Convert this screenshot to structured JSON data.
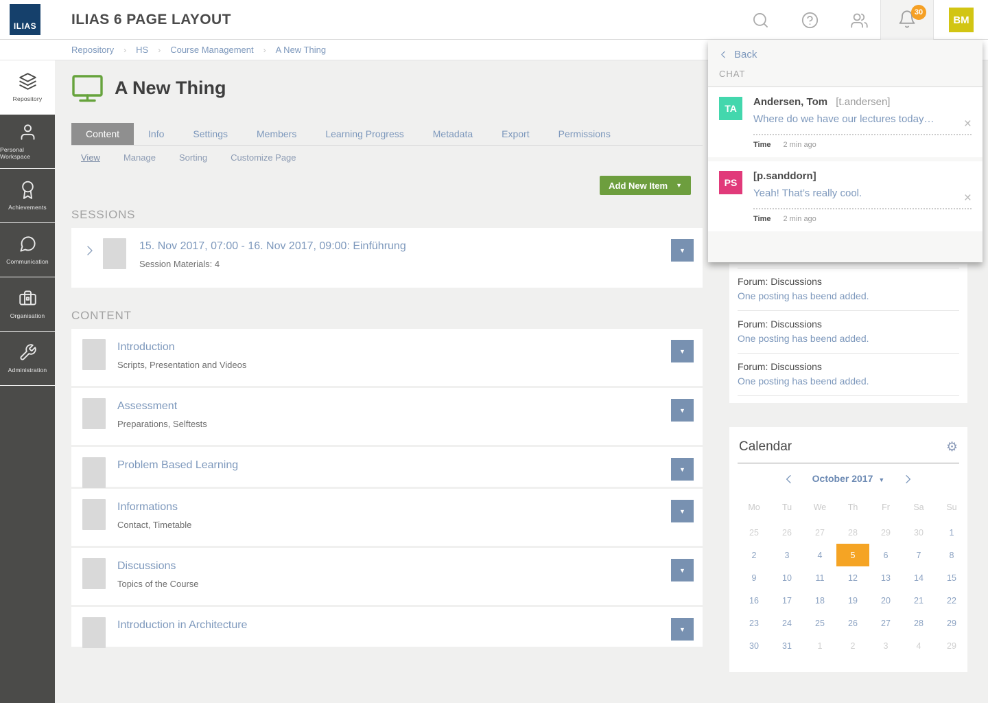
{
  "colors": {
    "accent_link": "#7d98bc",
    "green_button": "#6d9e3e",
    "orange_badge": "#f5a025",
    "orange_selected_day": "#f5a424",
    "navy_logo": "#15406b",
    "sidebar_dark": "#4b4b49",
    "avatar_bm": "#d2c513",
    "avatar_ta": "#43d7ad",
    "avatar_ps": "#e13a7a",
    "dropdown_blue": "#7891b1",
    "tab_active_gray": "#8f8f8f"
  },
  "header": {
    "logo_text": "ILIAS",
    "title": "ILIAS 6 PAGE LAYOUT",
    "icons": [
      "search-icon",
      "help-icon",
      "contacts-icon",
      "notifications-bell-icon"
    ],
    "notification_count": "30",
    "avatar_initials": "BM"
  },
  "breadcrumb": {
    "items": [
      "Repository",
      "HS",
      "Course Management",
      "A New Thing"
    ]
  },
  "sidebar": {
    "items": [
      {
        "label": "Repository",
        "icon": "layers-icon",
        "active": true
      },
      {
        "label": "Personal Workspace",
        "icon": "person-icon",
        "active": false
      },
      {
        "label": "Achievements",
        "icon": "award-icon",
        "active": false
      },
      {
        "label": "Communication",
        "icon": "speech-bubble-icon",
        "active": false
      },
      {
        "label": "Organisation",
        "icon": "briefcase-icon",
        "active": false
      },
      {
        "label": "Administration",
        "icon": "wrench-icon",
        "active": false
      }
    ]
  },
  "page": {
    "title": "A New Thing",
    "object_icon": "monitor-icon",
    "tabs": [
      "Content",
      "Info",
      "Settings",
      "Members",
      "Learning Progress",
      "Metadata",
      "Export",
      "Permissions"
    ],
    "active_tab": "Content",
    "subtabs": [
      "View",
      "Manage",
      "Sorting",
      "Customize Page"
    ],
    "active_subtab": "View",
    "add_button_label": "Add New Item",
    "sessions": {
      "heading": "SESSIONS",
      "items": [
        {
          "title": "15. Nov 2017, 07:00 - 16. Nov 2017, 09:00: Einführung",
          "subtitle": "Session Materials: 4"
        }
      ]
    },
    "content": {
      "heading": "CONTENT",
      "items": [
        {
          "title": "Introduction",
          "description": "Scripts, Presentation and Videos"
        },
        {
          "title": "Assessment",
          "description": "Preparations, Selftests"
        },
        {
          "title": "Problem Based Learning",
          "description": ""
        },
        {
          "title": "Informations",
          "description": "Contact, Timetable"
        },
        {
          "title": "Discussions",
          "description": "Topics of the Course"
        },
        {
          "title": "Introduction in Architecture",
          "description": ""
        }
      ]
    }
  },
  "chat_popup": {
    "back_label": "Back",
    "heading": "CHAT",
    "items": [
      {
        "initials": "TA",
        "avatar_color": "#43d7ad",
        "name": "Andersen, Tom",
        "handle": "[t.andersen]",
        "message": "Where do we have our lectures today…",
        "time_label": "Time",
        "time_value": "2 min ago"
      },
      {
        "initials": "PS",
        "avatar_color": "#e13a7a",
        "name": "[p.sanddorn]",
        "handle": "",
        "message": "Yeah! That’s really cool.",
        "time_label": "Time",
        "time_value": "2 min ago"
      }
    ]
  },
  "forum_panel": {
    "items": [
      {
        "title": "Forum: Discussions",
        "link": "One posting has beend added."
      },
      {
        "title": "Forum: Discussions",
        "link": "One posting has beend added."
      },
      {
        "title": "Forum: Discussions",
        "link": "One posting has beend added."
      }
    ]
  },
  "calendar": {
    "title": "Calendar",
    "settings_icon": "gear-icon",
    "month_label": "October 2017",
    "day_headers": [
      "Mo",
      "Tu",
      "We",
      "Th",
      "Fr",
      "Sa",
      "Su"
    ],
    "selected_day": "5",
    "weeks": [
      [
        {
          "d": "25",
          "m": 1
        },
        {
          "d": "26",
          "m": 1
        },
        {
          "d": "27",
          "m": 1
        },
        {
          "d": "28",
          "m": 1
        },
        {
          "d": "29",
          "m": 1
        },
        {
          "d": "30",
          "m": 1
        },
        {
          "d": "1"
        }
      ],
      [
        {
          "d": "2"
        },
        {
          "d": "3"
        },
        {
          "d": "4"
        },
        {
          "d": "5",
          "s": 1
        },
        {
          "d": "6"
        },
        {
          "d": "7"
        },
        {
          "d": "8"
        }
      ],
      [
        {
          "d": "9"
        },
        {
          "d": "10"
        },
        {
          "d": "11"
        },
        {
          "d": "12"
        },
        {
          "d": "13"
        },
        {
          "d": "14"
        },
        {
          "d": "15"
        }
      ],
      [
        {
          "d": "16"
        },
        {
          "d": "17"
        },
        {
          "d": "18"
        },
        {
          "d": "19"
        },
        {
          "d": "20"
        },
        {
          "d": "21"
        },
        {
          "d": "22"
        }
      ],
      [
        {
          "d": "23"
        },
        {
          "d": "24"
        },
        {
          "d": "25"
        },
        {
          "d": "26"
        },
        {
          "d": "27"
        },
        {
          "d": "28"
        },
        {
          "d": "29"
        }
      ],
      [
        {
          "d": "30"
        },
        {
          "d": "31"
        },
        {
          "d": "1",
          "m": 1
        },
        {
          "d": "2",
          "m": 1
        },
        {
          "d": "3",
          "m": 1
        },
        {
          "d": "4",
          "m": 1
        },
        {
          "d": "29",
          "m": 1
        }
      ]
    ]
  }
}
